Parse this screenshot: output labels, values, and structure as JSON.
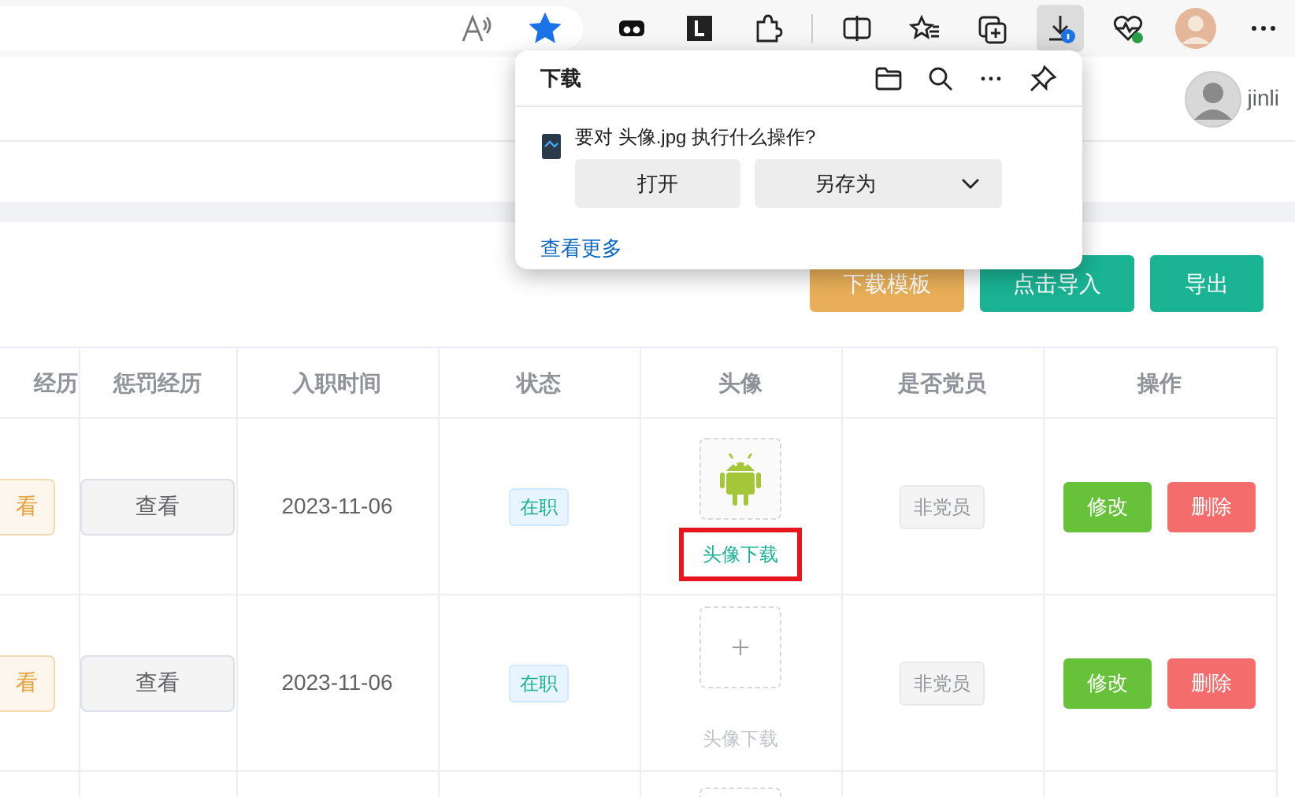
{
  "browser": {
    "favorite_on": true,
    "downloads_active": true
  },
  "user": {
    "name": "jinli"
  },
  "toolbar_buttons": [
    {
      "label": "下载模板",
      "kind": "warning"
    },
    {
      "label": "点击导入",
      "kind": "primary"
    },
    {
      "label": "导出",
      "kind": "primary"
    }
  ],
  "table": {
    "columns": [
      "经历",
      "惩罚经历",
      "入职时间",
      "状态",
      "头像",
      "是否党员",
      "操作"
    ],
    "rows": [
      {
        "column_1": "看",
        "punishment": "查看",
        "hire_date": "2023-11-06",
        "status": "在职",
        "avatar": {
          "has_image": true,
          "link": "头像下载",
          "enabled": true,
          "highlighted": true
        },
        "party": "非党员",
        "edit": "修改",
        "delete": "删除"
      },
      {
        "column_1": "看",
        "punishment": "查看",
        "hire_date": "2023-11-06",
        "status": "在职",
        "avatar": {
          "has_image": false,
          "link": "头像下载",
          "enabled": false,
          "highlighted": false
        },
        "party": "非党员",
        "edit": "修改",
        "delete": "删除"
      },
      {
        "partial": true
      }
    ]
  },
  "download_popup": {
    "title": "下载",
    "message": "要对 头像.jpg 执行什么操作?",
    "open": "打开",
    "save_as": "另存为",
    "more": "查看更多"
  }
}
